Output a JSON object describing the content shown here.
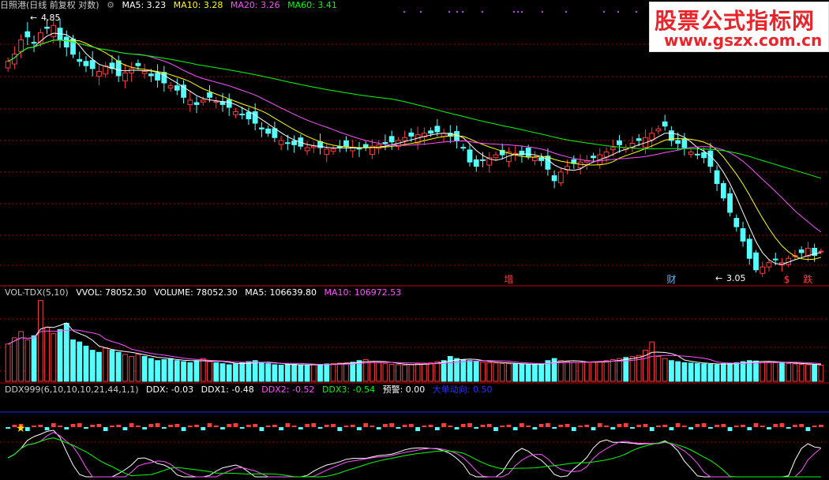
{
  "colors": {
    "up": "#ff3c3c",
    "down": "#54ffff",
    "ma5": "#ffffff",
    "ma10": "#ffff00",
    "ma20": "#ff50ff",
    "ma60": "#00ff00",
    "vol_ma5": "#ffffff",
    "vol_ma10": "#ff50ff",
    "ddx1": "#ffffff",
    "ddx2": "#ff50ff",
    "ddx3": "#00ff00",
    "warn": "#ffffff",
    "bigorder": "#3030ff",
    "grid": "#b00000",
    "signal": "#ff3c3c"
  },
  "main_header": {
    "title": "日照港(日线 前复权 对数)",
    "ma5": "MA5: 3.23",
    "ma10": "MA10: 3.28",
    "ma20": "MA20: 3.26",
    "ma60": "MA60: 3.41"
  },
  "vol_header": {
    "name": "VOL-TDX(5,10)",
    "vvol": "VVOL: 78052.30",
    "volume": "VOLUME: 78052.30",
    "ma5": "MA5: 106639.80",
    "ma10": "MA10: 106972.53"
  },
  "ddx_header": {
    "name": "DDX999(6,10,10,10,21,44,1,1)",
    "ddx": "DDX: -0.03",
    "ddx1": "DDX1: -0.48",
    "ddx2": "DDX2: -0.52",
    "ddx3": "DDX3: -0.54",
    "warn": "预警: 0.00",
    "bigorder": "大单动向: 0.50"
  },
  "watermark": {
    "line1": "股票公式指标网",
    "line2": "www.gszx.com.cn"
  },
  "annotations": {
    "high": "4.85",
    "low": "3.05"
  },
  "signals": [
    {
      "label": "增",
      "color": "#ff3c3c",
      "index": 77
    },
    {
      "label": "财",
      "color": "#5bb6ff",
      "index": 102
    },
    {
      "label": "$",
      "color": "#ff3c3c",
      "index": 120
    },
    {
      "label": "跌",
      "color": "#ff3c3c",
      "index": 123
    }
  ],
  "chart_data": [
    {
      "type": "candlestick",
      "title": "日照港(日线 前复权 对数)",
      "ylim": [
        3.0,
        4.9
      ],
      "annotations": [
        {
          "text": "4.85",
          "value": 4.85
        },
        {
          "text": "3.05",
          "value": 3.05
        }
      ],
      "series": [
        {
          "name": "MA5",
          "value_last": 3.23
        },
        {
          "name": "MA10",
          "value_last": 3.28
        },
        {
          "name": "MA20",
          "value_last": 3.26
        },
        {
          "name": "MA60",
          "value_last": 3.41
        }
      ],
      "close": [
        4.55,
        4.6,
        4.7,
        4.72,
        4.68,
        4.75,
        4.78,
        4.8,
        4.7,
        4.65,
        4.6,
        4.55,
        4.52,
        4.5,
        4.48,
        4.52,
        4.5,
        4.45,
        4.47,
        4.5,
        4.52,
        4.48,
        4.45,
        4.42,
        4.4,
        4.38,
        4.35,
        4.3,
        4.28,
        4.25,
        4.28,
        4.3,
        4.27,
        4.25,
        4.23,
        4.2,
        4.18,
        4.15,
        4.12,
        4.08,
        4.05,
        4.02,
        4.0,
        3.98,
        3.97,
        3.96,
        3.95,
        3.96,
        3.95,
        3.94,
        3.94,
        3.95,
        3.96,
        3.95,
        3.94,
        3.95,
        3.96,
        3.97,
        3.98,
        3.99,
        4.0,
        4.02,
        4.03,
        4.04,
        4.05,
        4.05,
        4.06,
        4.05,
        4.03,
        4.0,
        3.95,
        3.85,
        3.82,
        3.86,
        3.88,
        3.9,
        3.9,
        3.92,
        3.91,
        3.9,
        3.89,
        3.88,
        3.86,
        3.8,
        3.72,
        3.78,
        3.82,
        3.84,
        3.85,
        3.86,
        3.88,
        3.9,
        3.92,
        3.95,
        3.97,
        3.95,
        3.98,
        4.0,
        4.02,
        4.05,
        4.08,
        4.1,
        4.0,
        3.98,
        3.95,
        3.92,
        3.9,
        3.88,
        3.82,
        3.7,
        3.6,
        3.5,
        3.4,
        3.3,
        3.18,
        3.1,
        3.12,
        3.15,
        3.17,
        3.15,
        3.18,
        3.2,
        3.22,
        3.25,
        3.2,
        3.23
      ]
    },
    {
      "type": "bar",
      "title": "VOL-TDX(5,10)",
      "series": [
        {
          "name": "VOLUME",
          "value_last": 78052.3
        },
        {
          "name": "MA5",
          "value_last": 106639.8
        },
        {
          "name": "MA10",
          "value_last": 106972.53
        }
      ],
      "ylim": [
        0,
        400000
      ],
      "values": [
        180000,
        210000,
        240000,
        200000,
        220000,
        390000,
        260000,
        230000,
        250000,
        280000,
        200000,
        190000,
        170000,
        150000,
        140000,
        160000,
        150000,
        140000,
        130000,
        120000,
        130000,
        120000,
        110000,
        100000,
        105000,
        110000,
        100000,
        95000,
        90000,
        100000,
        110000,
        95000,
        90000,
        85000,
        80000,
        85000,
        90000,
        95000,
        100000,
        90000,
        85000,
        80000,
        78000,
        80000,
        82000,
        80000,
        78000,
        80000,
        82000,
        84000,
        86000,
        88000,
        90000,
        92000,
        100000,
        105000,
        95000,
        90000,
        85000,
        82000,
        80000,
        78000,
        80000,
        85000,
        88000,
        90000,
        95000,
        100000,
        120000,
        110000,
        105000,
        100000,
        95000,
        92000,
        90000,
        88000,
        86000,
        85000,
        84000,
        82000,
        80000,
        82000,
        85000,
        100000,
        110000,
        100000,
        95000,
        92000,
        90000,
        92000,
        94000,
        96000,
        100000,
        105000,
        110000,
        115000,
        120000,
        125000,
        150000,
        190000,
        120000,
        110000,
        100000,
        95000,
        90000,
        88000,
        86000,
        84000,
        82000,
        80000,
        85000,
        88000,
        90000,
        95000,
        100000,
        98000,
        95000,
        92000,
        90000,
        88000,
        86000,
        84000,
        82000,
        80000,
        80000,
        78052
      ]
    },
    {
      "type": "line",
      "title": "DDX999(6,10,10,10,21,44,1,1)",
      "series": [
        {
          "name": "DDX",
          "value_last": -0.03
        },
        {
          "name": "DDX1",
          "value_last": -0.48
        },
        {
          "name": "DDX2",
          "value_last": -0.52
        },
        {
          "name": "DDX3",
          "value_last": -0.54
        },
        {
          "name": "预警",
          "value_last": 0.0
        },
        {
          "name": "大单动向",
          "value_last": 0.5
        }
      ]
    }
  ]
}
